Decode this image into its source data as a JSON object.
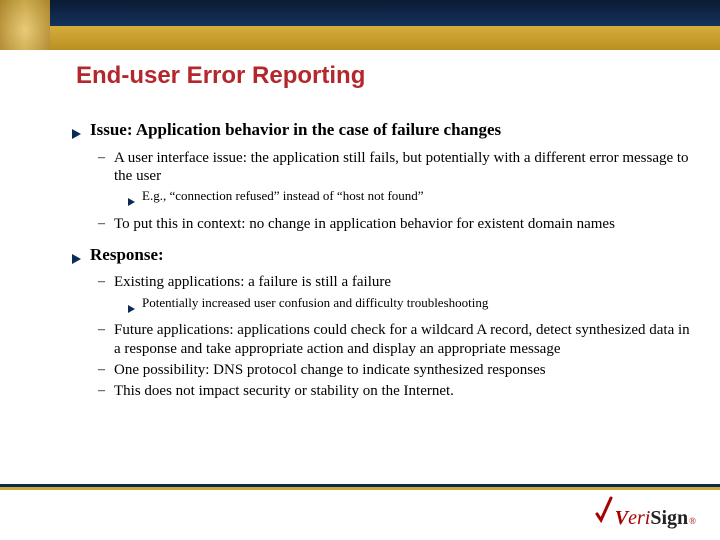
{
  "title": "End-user Error Reporting",
  "sections": [
    {
      "label": "Issue: Application behavior in the case of failure changes",
      "subs": [
        {
          "label": "A user interface issue: the application still fails, but potentially with a different error message to the user",
          "subs": [
            {
              "label": "E.g., “connection refused” instead of “host not found”"
            }
          ]
        },
        {
          "label": "To put this in context: no change in application behavior for existent domain names"
        }
      ]
    },
    {
      "label": "Response:",
      "subs": [
        {
          "label": "Existing applications: a failure is still a failure",
          "subs": [
            {
              "label": "Potentially increased user confusion and difficulty troubleshooting"
            }
          ]
        },
        {
          "label": "Future applications: applications could check for a wildcard A record, detect synthesized data in a response and take appropriate action and display an appropriate message"
        },
        {
          "label": "One possibility: DNS protocol change to indicate synthesized responses"
        },
        {
          "label": "This does not impact security or stability on the Internet."
        }
      ]
    }
  ],
  "logo": {
    "v": "V",
    "eri": "eri",
    "sign": "Sign",
    "reg": "®"
  }
}
